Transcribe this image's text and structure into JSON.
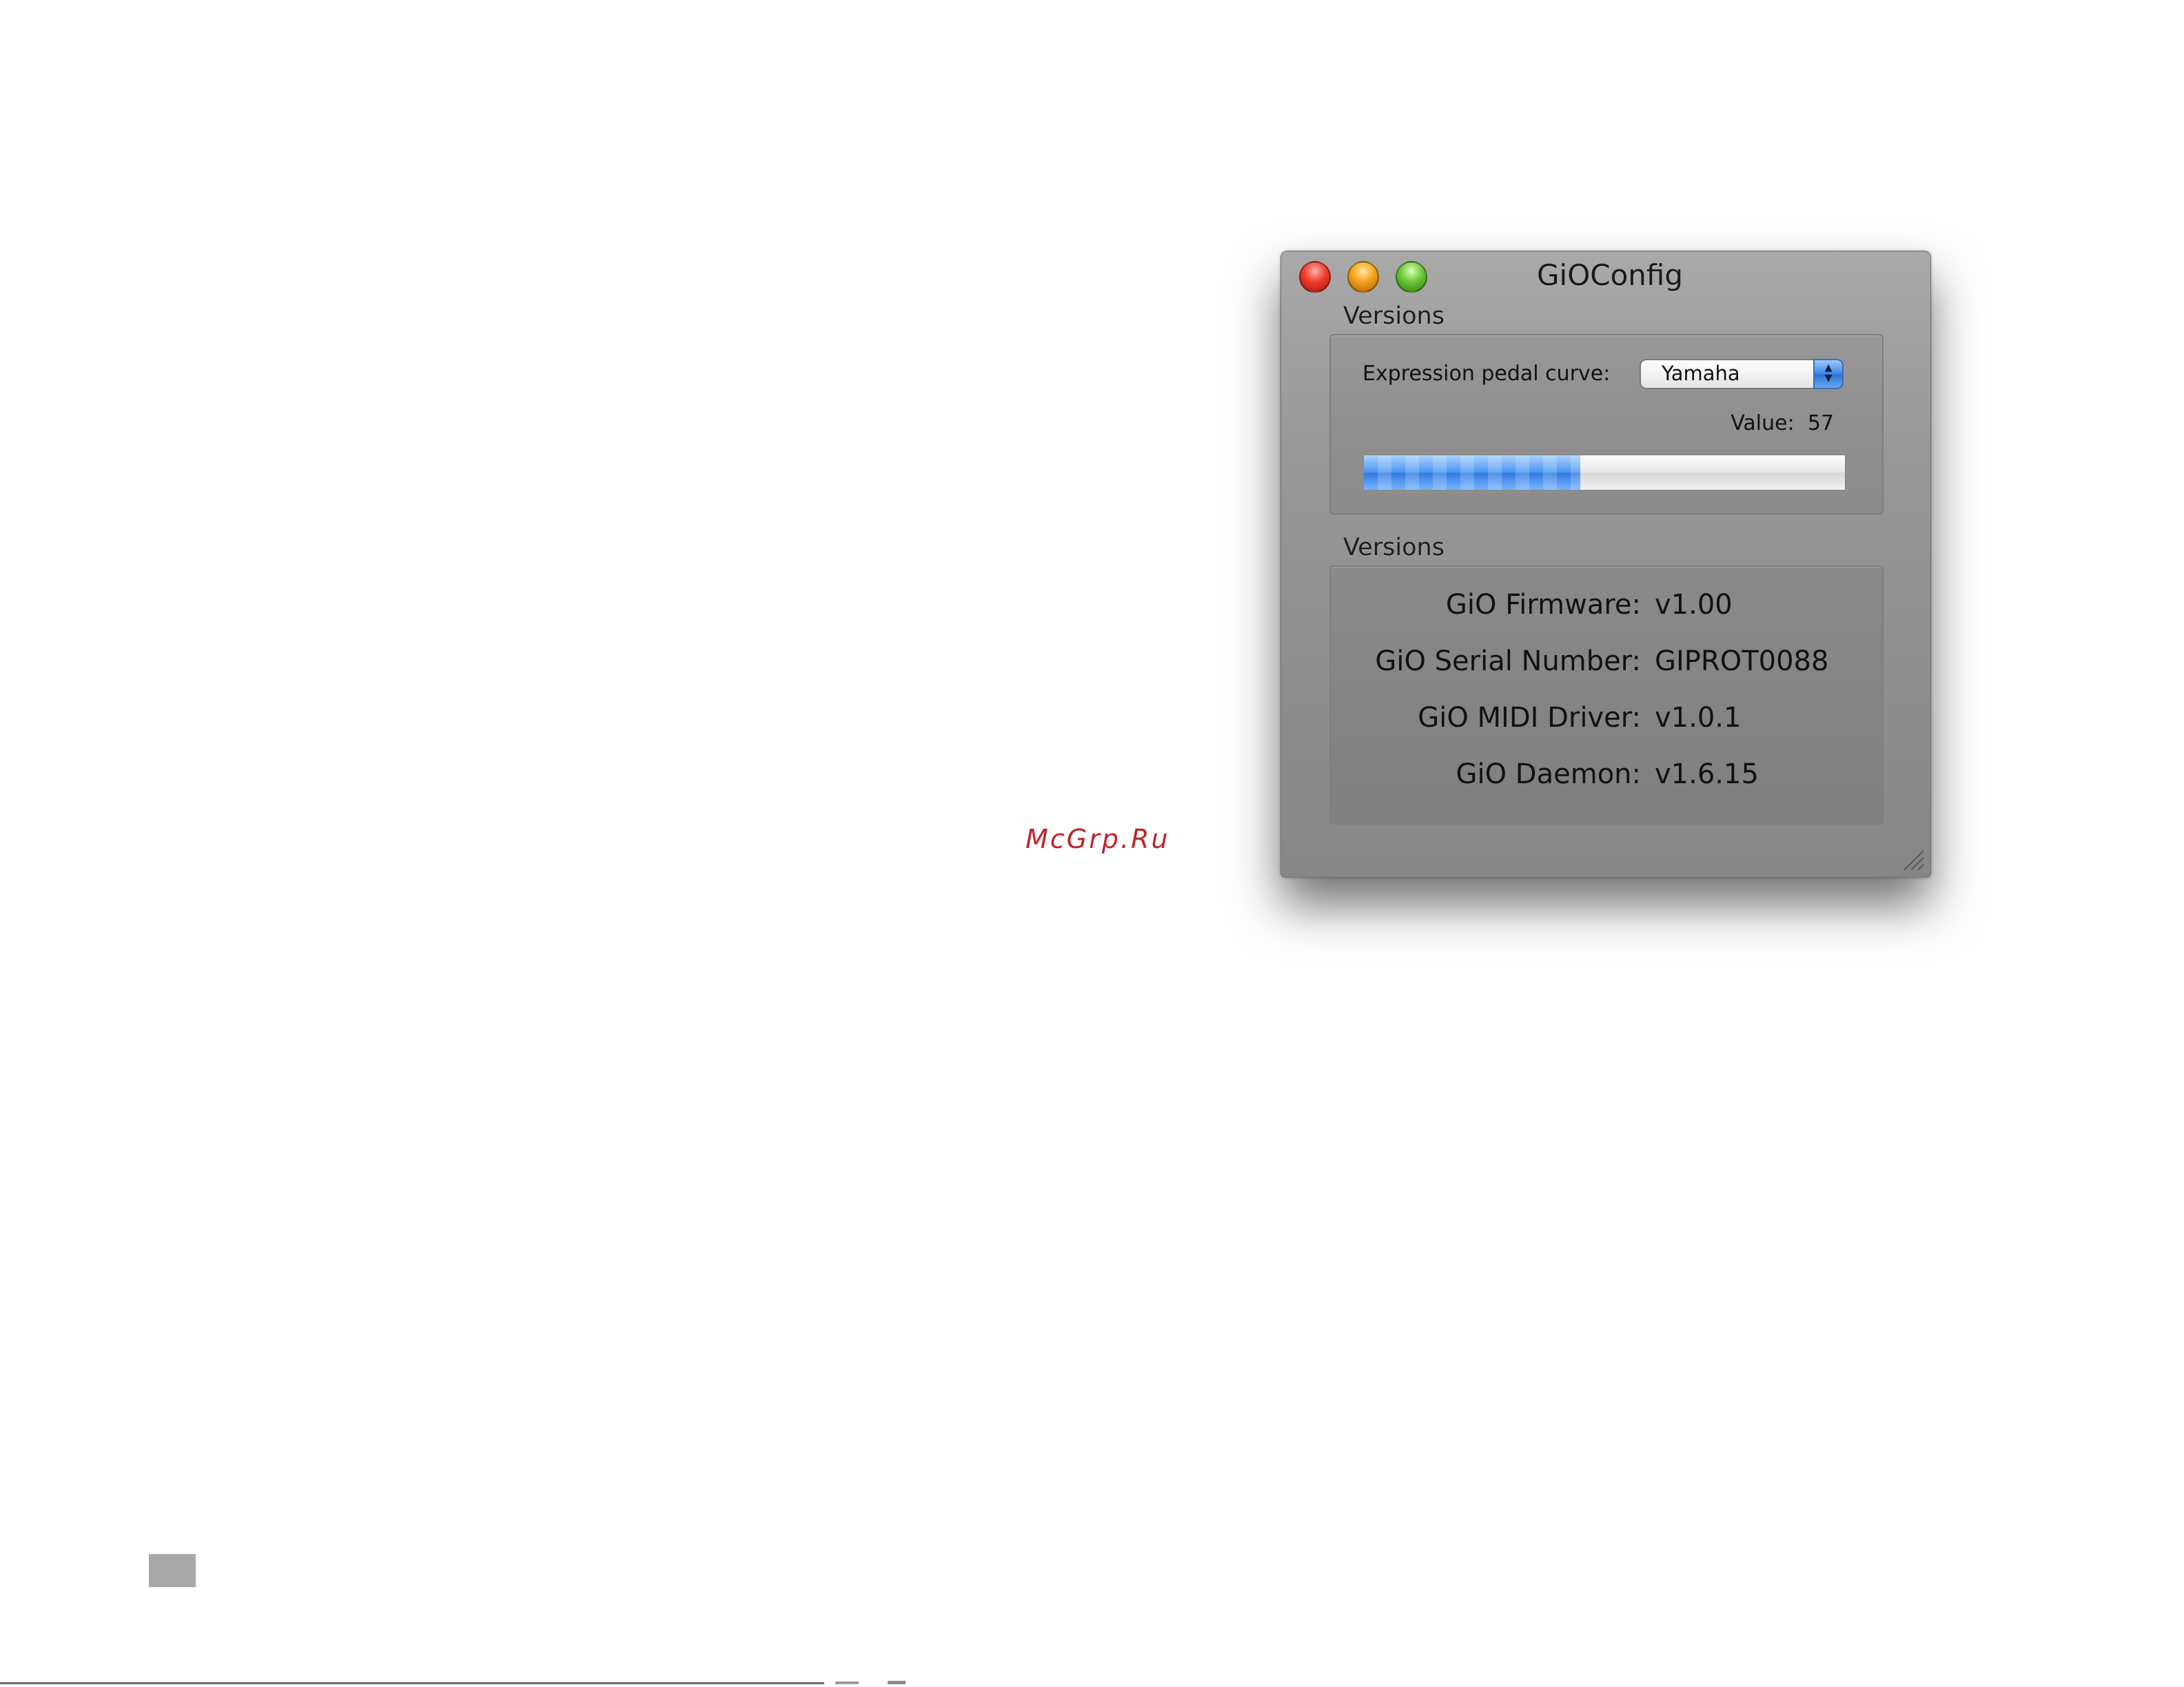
{
  "window": {
    "title": "GiOConfig"
  },
  "pedal_section": {
    "heading": "Versions",
    "pedal_curve_label": "Expression pedal curve:",
    "pedal_curve_selected": "Yamaha",
    "value_label": "Value:",
    "value": "57",
    "level_percent": 45,
    "accent_color": "#3a84e6"
  },
  "versions_section": {
    "heading": "Versions",
    "rows": [
      {
        "label": "GiO Firmware:",
        "value": "v1.00"
      },
      {
        "label": "GiO Serial Number:",
        "value": "GIPROT0088"
      },
      {
        "label": "GiO MIDI Driver:",
        "value": "v1.0.1"
      },
      {
        "label": "GiO Daemon:",
        "value": "v1.6.15"
      }
    ]
  },
  "watermark": "McGrp.Ru",
  "icons": {
    "close": "close-button-icon",
    "minimize": "minimize-button-icon",
    "zoom": "zoom-button-icon",
    "popup": "updown-arrows-icon",
    "resize": "resize-grip-icon"
  }
}
